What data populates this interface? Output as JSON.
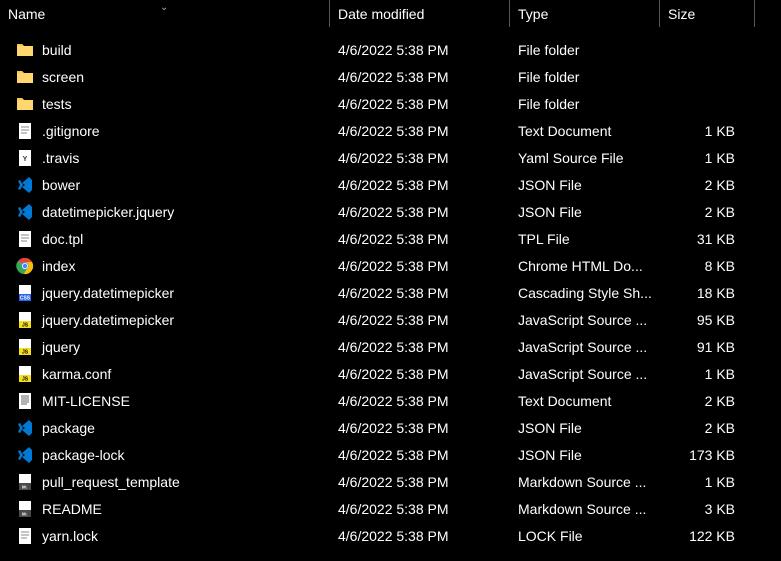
{
  "columns": {
    "name": "Name",
    "date": "Date modified",
    "type": "Type",
    "size": "Size"
  },
  "files": [
    {
      "icon": "folder",
      "name": "build",
      "date": "4/6/2022 5:38 PM",
      "type": "File folder",
      "size": ""
    },
    {
      "icon": "folder",
      "name": "screen",
      "date": "4/6/2022 5:38 PM",
      "type": "File folder",
      "size": ""
    },
    {
      "icon": "folder",
      "name": "tests",
      "date": "4/6/2022 5:38 PM",
      "type": "File folder",
      "size": ""
    },
    {
      "icon": "text",
      "name": ".gitignore",
      "date": "4/6/2022 5:38 PM",
      "type": "Text Document",
      "size": "1 KB"
    },
    {
      "icon": "yaml",
      "name": ".travis",
      "date": "4/6/2022 5:38 PM",
      "type": "Yaml Source File",
      "size": "1 KB"
    },
    {
      "icon": "vscode",
      "name": "bower",
      "date": "4/6/2022 5:38 PM",
      "type": "JSON File",
      "size": "2 KB"
    },
    {
      "icon": "vscode",
      "name": "datetimepicker.jquery",
      "date": "4/6/2022 5:38 PM",
      "type": "JSON File",
      "size": "2 KB"
    },
    {
      "icon": "text",
      "name": "doc.tpl",
      "date": "4/6/2022 5:38 PM",
      "type": "TPL File",
      "size": "31 KB"
    },
    {
      "icon": "chrome",
      "name": "index",
      "date": "4/6/2022 5:38 PM",
      "type": "Chrome HTML Do...",
      "size": "8 KB"
    },
    {
      "icon": "css",
      "name": "jquery.datetimepicker",
      "date": "4/6/2022 5:38 PM",
      "type": "Cascading Style Sh...",
      "size": "18 KB"
    },
    {
      "icon": "js",
      "name": "jquery.datetimepicker",
      "date": "4/6/2022 5:38 PM",
      "type": "JavaScript Source ...",
      "size": "95 KB"
    },
    {
      "icon": "js",
      "name": "jquery",
      "date": "4/6/2022 5:38 PM",
      "type": "JavaScript Source ...",
      "size": "91 KB"
    },
    {
      "icon": "js",
      "name": "karma.conf",
      "date": "4/6/2022 5:38 PM",
      "type": "JavaScript Source ...",
      "size": "1 KB"
    },
    {
      "icon": "textlines",
      "name": "MIT-LICENSE",
      "date": "4/6/2022 5:38 PM",
      "type": "Text Document",
      "size": "2 KB"
    },
    {
      "icon": "vscode",
      "name": "package",
      "date": "4/6/2022 5:38 PM",
      "type": "JSON File",
      "size": "2 KB"
    },
    {
      "icon": "vscode",
      "name": "package-lock",
      "date": "4/6/2022 5:38 PM",
      "type": "JSON File",
      "size": "173 KB"
    },
    {
      "icon": "md",
      "name": "pull_request_template",
      "date": "4/6/2022 5:38 PM",
      "type": "Markdown Source ...",
      "size": "1 KB"
    },
    {
      "icon": "md",
      "name": "README",
      "date": "4/6/2022 5:38 PM",
      "type": "Markdown Source ...",
      "size": "3 KB"
    },
    {
      "icon": "text",
      "name": "yarn.lock",
      "date": "4/6/2022 5:38 PM",
      "type": "LOCK File",
      "size": "122 KB"
    }
  ]
}
